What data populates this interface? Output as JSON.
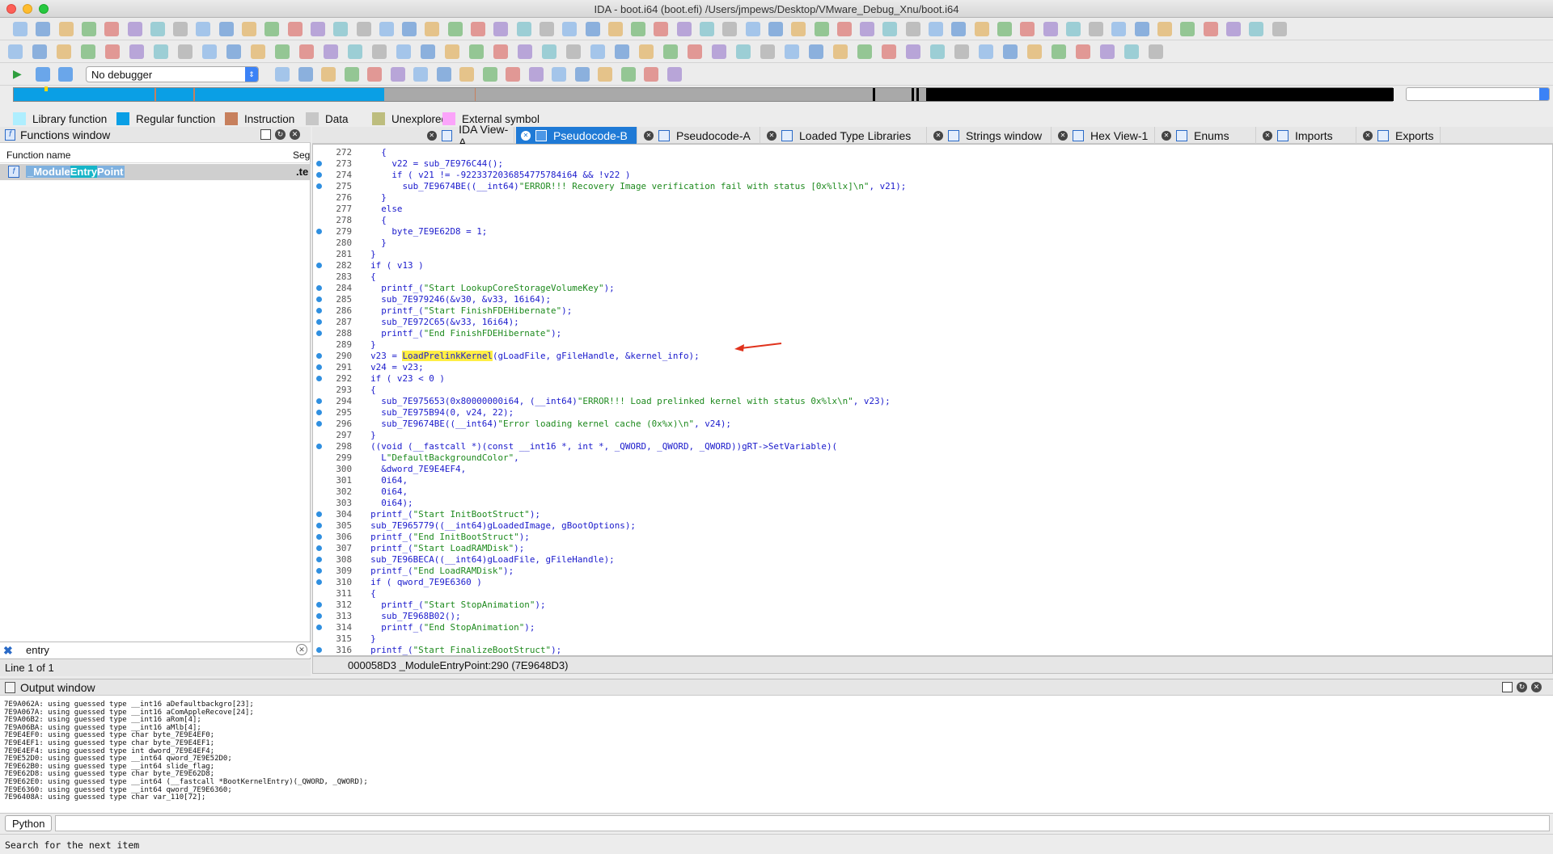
{
  "window": {
    "title": "IDA - boot.i64 (boot.efi) /Users/jmpews/Desktop/VMware_Debug_Xnu/boot.i64"
  },
  "debugger": {
    "selected": "No debugger"
  },
  "legend": [
    {
      "label": "Library function",
      "color": "#aeeefe"
    },
    {
      "label": "Regular function",
      "color": "#0a9fe5"
    },
    {
      "label": "Instruction",
      "color": "#c7805d"
    },
    {
      "label": "Data",
      "color": "#c7c7c7"
    },
    {
      "label": "Unexplored",
      "color": "#bdbd7e"
    },
    {
      "label": "External symbol",
      "color": "#fba4fa"
    }
  ],
  "functions": {
    "title": "Functions window",
    "col_name": "Function name",
    "col_seg": "Seg",
    "row": {
      "pre": "_Module",
      "match": "Entry",
      "post": "Point",
      "seg": ".te"
    },
    "search": "entry",
    "line_of": "Line 1 of 1"
  },
  "tabs": [
    {
      "label": "IDA View-A",
      "active": false
    },
    {
      "label": "Pseudocode-B",
      "active": true
    },
    {
      "label": "Pseudocode-A",
      "active": false
    },
    {
      "label": "Loaded Type Libraries",
      "active": false
    },
    {
      "label": "Strings window",
      "active": false
    },
    {
      "label": "Hex View-1",
      "active": false
    },
    {
      "label": "Enums",
      "active": false
    },
    {
      "label": "Imports",
      "active": false
    },
    {
      "label": "Exports",
      "active": false
    }
  ],
  "code": {
    "lines": [
      {
        "n": "272",
        "dot": false,
        "t": "    {"
      },
      {
        "n": "273",
        "dot": true,
        "t": "      v22 = sub_7E976C44();"
      },
      {
        "n": "274",
        "dot": true,
        "t": "      if ( v21 != -9223372036854775784i64 && !v22 )"
      },
      {
        "n": "275",
        "dot": true,
        "t": "        sub_7E9674BE((__int64)\"ERROR!!! Recovery Image verification fail with status [0x%llx]\\n\", v21);"
      },
      {
        "n": "276",
        "dot": false,
        "t": "    }"
      },
      {
        "n": "277",
        "dot": false,
        "t": "    else"
      },
      {
        "n": "278",
        "dot": false,
        "t": "    {"
      },
      {
        "n": "279",
        "dot": true,
        "t": "      byte_7E9E62D8 = 1;"
      },
      {
        "n": "280",
        "dot": false,
        "t": "    }"
      },
      {
        "n": "281",
        "dot": false,
        "t": "  }"
      },
      {
        "n": "282",
        "dot": true,
        "t": "  if ( v13 )"
      },
      {
        "n": "283",
        "dot": false,
        "t": "  {"
      },
      {
        "n": "284",
        "dot": true,
        "t": "    printf_(\"Start LookupCoreStorageVolumeKey\");"
      },
      {
        "n": "285",
        "dot": true,
        "t": "    sub_7E979246(&v30, &v33, 16i64);"
      },
      {
        "n": "286",
        "dot": true,
        "t": "    printf_(\"Start FinishFDEHibernate\");"
      },
      {
        "n": "287",
        "dot": true,
        "t": "    sub_7E972C65(&v33, 16i64);"
      },
      {
        "n": "288",
        "dot": true,
        "t": "    printf_(\"End FinishFDEHibernate\");"
      },
      {
        "n": "289",
        "dot": false,
        "t": "  }"
      },
      {
        "n": "290",
        "dot": true,
        "t": "  v23 = LoadPrelinkKernel(gLoadFile, gFileHandle, &kernel_info);"
      },
      {
        "n": "291",
        "dot": true,
        "t": "  v24 = v23;"
      },
      {
        "n": "292",
        "dot": true,
        "t": "  if ( v23 < 0 )"
      },
      {
        "n": "293",
        "dot": false,
        "t": "  {"
      },
      {
        "n": "294",
        "dot": true,
        "t": "    sub_7E975653(0x80000000i64, (__int64)\"ERROR!!! Load prelinked kernel with status 0x%lx\\n\", v23);"
      },
      {
        "n": "295",
        "dot": true,
        "t": "    sub_7E975B94(0, v24, 22);"
      },
      {
        "n": "296",
        "dot": true,
        "t": "    sub_7E9674BE((__int64)\"Error loading kernel cache (0x%x)\\n\", v24);"
      },
      {
        "n": "297",
        "dot": false,
        "t": "  }"
      },
      {
        "n": "298",
        "dot": true,
        "t": "  ((void (__fastcall *)(const __int16 *, int *, _QWORD, _QWORD, _QWORD))gRT->SetVariable)("
      },
      {
        "n": "299",
        "dot": false,
        "t": "    L\"DefaultBackgroundColor\","
      },
      {
        "n": "300",
        "dot": false,
        "t": "    &dword_7E9E4EF4,"
      },
      {
        "n": "301",
        "dot": false,
        "t": "    0i64,"
      },
      {
        "n": "302",
        "dot": false,
        "t": "    0i64,"
      },
      {
        "n": "303",
        "dot": false,
        "t": "    0i64);"
      },
      {
        "n": "304",
        "dot": true,
        "t": "  printf_(\"Start InitBootStruct\");"
      },
      {
        "n": "305",
        "dot": true,
        "t": "  sub_7E965779((__int64)gLoadedImage, gBootOptions);"
      },
      {
        "n": "306",
        "dot": true,
        "t": "  printf_(\"End InitBootStruct\");"
      },
      {
        "n": "307",
        "dot": true,
        "t": "  printf_(\"Start LoadRAMDisk\");"
      },
      {
        "n": "308",
        "dot": true,
        "t": "  sub_7E96BECA((__int64)gLoadFile, gFileHandle);"
      },
      {
        "n": "309",
        "dot": true,
        "t": "  printf_(\"End LoadRAMDisk\");"
      },
      {
        "n": "310",
        "dot": true,
        "t": "  if ( qword_7E9E6360 )"
      },
      {
        "n": "311",
        "dot": false,
        "t": "  {"
      },
      {
        "n": "312",
        "dot": true,
        "t": "    printf_(\"Start StopAnimation\");"
      },
      {
        "n": "313",
        "dot": true,
        "t": "    sub_7E968B02();"
      },
      {
        "n": "314",
        "dot": true,
        "t": "    printf_(\"End StopAnimation\");"
      },
      {
        "n": "315",
        "dot": false,
        "t": "  }"
      },
      {
        "n": "316",
        "dot": true,
        "t": "  printf_(\"Start FinalizeBootStruct\");"
      }
    ],
    "status": "000058D3 _ModuleEntryPoint:290 (7E9648D3)"
  },
  "output": {
    "title": "Output window",
    "lines": [
      "7E9A062A: using guessed type __int16 aDefaultbackgro[23];",
      "7E9A067A: using guessed type __int16 aComAppleRecove[24];",
      "7E9A06B2: using guessed type __int16 aRom[4];",
      "7E9A06BA: using guessed type __int16 aMlb[4];",
      "7E9E4EF0: using guessed type char byte_7E9E4EF0;",
      "7E9E4EF1: using guessed type char byte_7E9E4EF1;",
      "7E9E4EF4: using guessed type int dword_7E9E4EF4;",
      "7E9E52D0: using guessed type __int64 qword_7E9E52D0;",
      "7E9E62B0: using guessed type __int64 slide_flag;",
      "7E9E62D8: using guessed type char byte_7E9E62D8;",
      "7E9E62E0: using guessed type __int64 (__fastcall *BootKernelEntry)(_QWORD, _QWORD);",
      "7E9E6360: using guessed type __int64 qword_7E9E6360;",
      "7E96408A: using guessed type char var_110[72];"
    ],
    "python_label": "Python"
  },
  "statusbar": {
    "text": "Search for the next item"
  }
}
